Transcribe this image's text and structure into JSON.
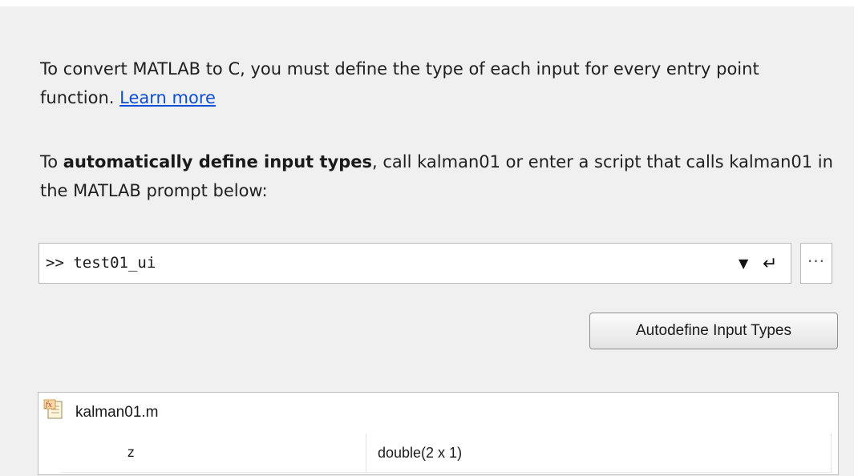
{
  "intro": {
    "text": "To convert MATLAB to C, you must define the type of each input for every entry point function.",
    "learn_more_label": "Learn more"
  },
  "auto": {
    "prefix": "To ",
    "bold": "automatically define input types",
    "suffix": ", call kalman01 or enter a script that calls kalman01 in the MATLAB prompt below:"
  },
  "prompt": {
    "value": ">> test01_ui",
    "dropdown_icon": "▼",
    "enter_icon": "↵",
    "more_label": "···"
  },
  "autodefine_button_label": "Autodefine Input Types",
  "entry_points": [
    {
      "file": "kalman01.m",
      "icon": "function-file-icon",
      "inputs": [
        {
          "name": "z",
          "type": "double(2 x 1)"
        }
      ]
    }
  ],
  "colors": {
    "panel_background": "#f0f0f0",
    "link": "#0b4fd6"
  }
}
